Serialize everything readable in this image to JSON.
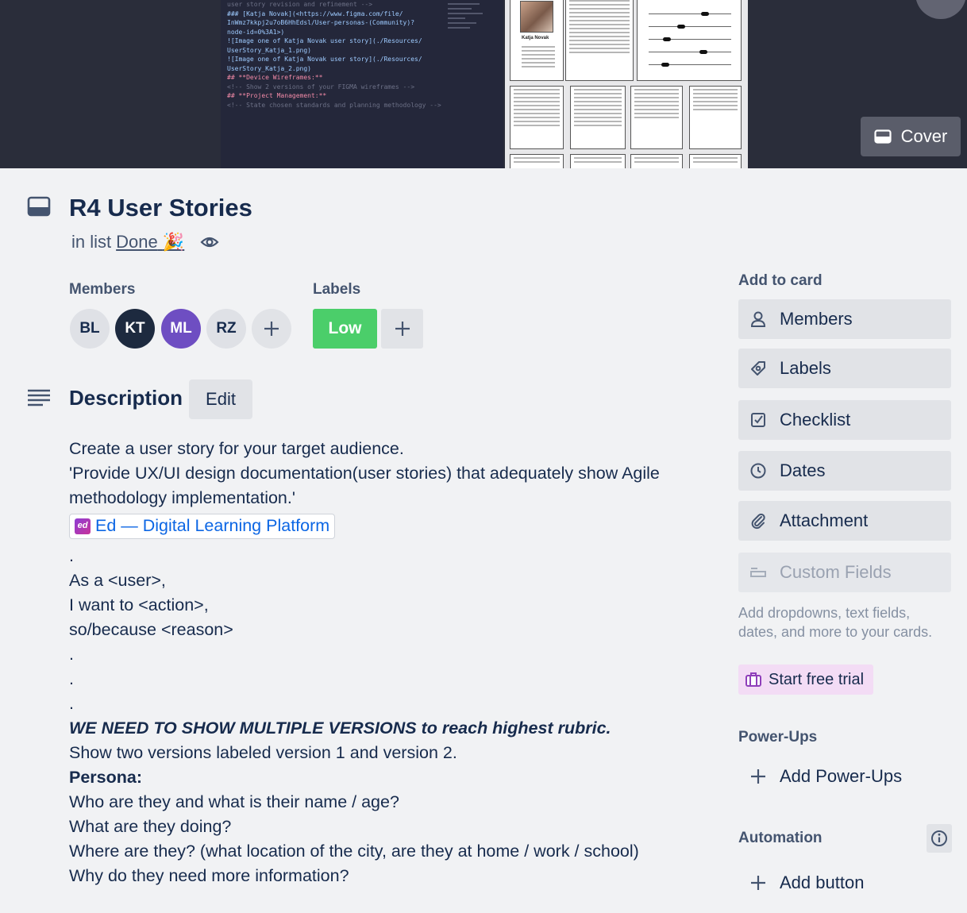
{
  "cover": {
    "code_lines": [
      {
        "cls": "c-com",
        "text": "user story revision and refinement -->"
      },
      {
        "cls": "c-link",
        "text": "### [Katja Novak](<https://www.figma.com/file/"
      },
      {
        "cls": "c-link",
        "text": "InWmz7kkpj2u7oB6HhEdsl/User-personas-(Community)?"
      },
      {
        "cls": "c-link",
        "text": "node-id=0%3A1>)"
      },
      {
        "cls": "c-txt",
        "text": ""
      },
      {
        "cls": "c-link",
        "text": "![Image one of Katja Novak user story](./Resources/"
      },
      {
        "cls": "c-link",
        "text": "UserStory_Katja_1.png)"
      },
      {
        "cls": "c-link",
        "text": "![Image one of Katja Novak user story](./Resources/"
      },
      {
        "cls": "c-link",
        "text": "UserStory_Katja_2.png)"
      },
      {
        "cls": "c-txt",
        "text": ""
      },
      {
        "cls": "c-head",
        "text": "## **Device Wireframes:**"
      },
      {
        "cls": "c-txt",
        "text": ""
      },
      {
        "cls": "c-com",
        "text": "<!-- Show 2 versions of your FIGMA wireframes -->"
      },
      {
        "cls": "c-txt",
        "text": ""
      },
      {
        "cls": "c-head",
        "text": "## **Project Management:**"
      },
      {
        "cls": "c-txt",
        "text": ""
      },
      {
        "cls": "c-com",
        "text": "<!-- State chosen standards and planning methodology -->"
      }
    ],
    "persona_name": "Katja Novak",
    "cover_button_label": "Cover"
  },
  "card": {
    "title": "R4 User Stories",
    "list_prefix": "in list",
    "list_name": "Done",
    "list_emoji": "🎉"
  },
  "members": {
    "label": "Members",
    "avatars": [
      {
        "initials": "BL",
        "bg": "#dfe1e6",
        "fg": "#172b4d"
      },
      {
        "initials": "KT",
        "bg": "#1d2a3f",
        "fg": "#ffffff"
      },
      {
        "initials": "ML",
        "bg": "#6e4ec2",
        "fg": "#ffffff"
      },
      {
        "initials": "RZ",
        "bg": "#dfe1e6",
        "fg": "#172b4d"
      }
    ]
  },
  "labels": {
    "label": "Labels",
    "items": [
      {
        "text": "Low",
        "color": "#4bce6a"
      }
    ]
  },
  "description": {
    "title": "Description",
    "edit_label": "Edit",
    "intro_lines": [
      "Create a user story for your target audience.",
      "'Provide UX/UI design documentation(user stories) that adequately show Agile methodology implementation.'"
    ],
    "link_logo": "ed",
    "link_text": "Ed — Digital Learning Platform",
    "template_lines": [
      ".",
      "As a <user>,",
      "I want to <action>,",
      "so/because <reason>",
      ".",
      ".",
      "."
    ],
    "emphasis": "WE NEED TO SHOW MULTIPLE VERSIONS to reach highest rubric.",
    "versions_line": "Show two versions labeled version 1 and version 2.",
    "persona_heading": "Persona:",
    "persona_lines": [
      "Who are they and what is their name / age?",
      "What are they doing?",
      "Where are they? (what location of the city, are they at home / work / school)",
      "Why do they need more information?"
    ]
  },
  "sidebar": {
    "add_to_card": "Add to card",
    "buttons": [
      {
        "label": "Members",
        "icon": "person-icon"
      },
      {
        "label": "Labels",
        "icon": "tag-icon"
      },
      {
        "label": "Checklist",
        "icon": "checklist-icon"
      },
      {
        "label": "Dates",
        "icon": "clock-icon"
      },
      {
        "label": "Attachment",
        "icon": "paperclip-icon"
      },
      {
        "label": "Custom Fields",
        "icon": "custom-fields-icon"
      }
    ],
    "custom_fields_note": "Add dropdowns, text fields, dates, and more to your cards.",
    "trial_label": "Start free trial",
    "powerups_title": "Power-Ups",
    "add_powerups": "Add Power-Ups",
    "automation_title": "Automation",
    "add_button": "Add button"
  }
}
